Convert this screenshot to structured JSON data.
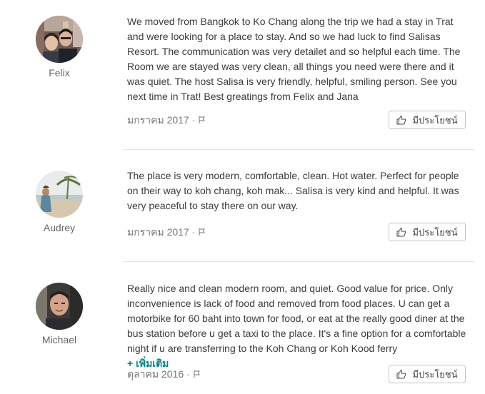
{
  "reviews": [
    {
      "name": "Felix",
      "text": "We moved from Bangkok to Ko Chang along the trip we had a stay in Trat and were looking for a place to stay. And so we had luck to find Salisas Resort. The communication was very detailet and so helpful each time. The Room we are stayed was very clean, all things you need were there and it was quiet. The host Salisa is very friendly, helpful, smiling person. See you next time in Trat! Best greatings from Felix and Jana",
      "date": "มกราคม 2017",
      "separator": "·",
      "helpful_label": "มีประโยชน์"
    },
    {
      "name": "Audrey",
      "text": "The place is very modern, comfortable, clean. Hot water. Perfect for people on their way to koh chang, koh mak... Salisa is very kind and helpful. It was very peaceful to stay there on our way.",
      "date": "มกราคม 2017",
      "separator": "·",
      "helpful_label": "มีประโยชน์"
    },
    {
      "name": "Michael",
      "text": "Really nice and clean modern room, and quiet. Good value for price. Only inconvenience is lack of food and removed from food places. U can get a motorbike for 60 baht into town for food, or eat at the really good diner at the bus station before u get a taxi to the place. It's a fine option for a comfortable night if u are transferring to the Koh Chang or Koh Kood ferry",
      "more_label": "+ เพิ่มเติม",
      "date": "ตุลาคม 2016",
      "separator": "·",
      "helpful_label": "มีประโยชน์"
    }
  ],
  "colors": {
    "link": "#008489",
    "divider": "#e4e4e4",
    "meta": "#767676"
  },
  "icons": {
    "flag": "flag-icon",
    "thumb": "thumbs-up-icon"
  }
}
